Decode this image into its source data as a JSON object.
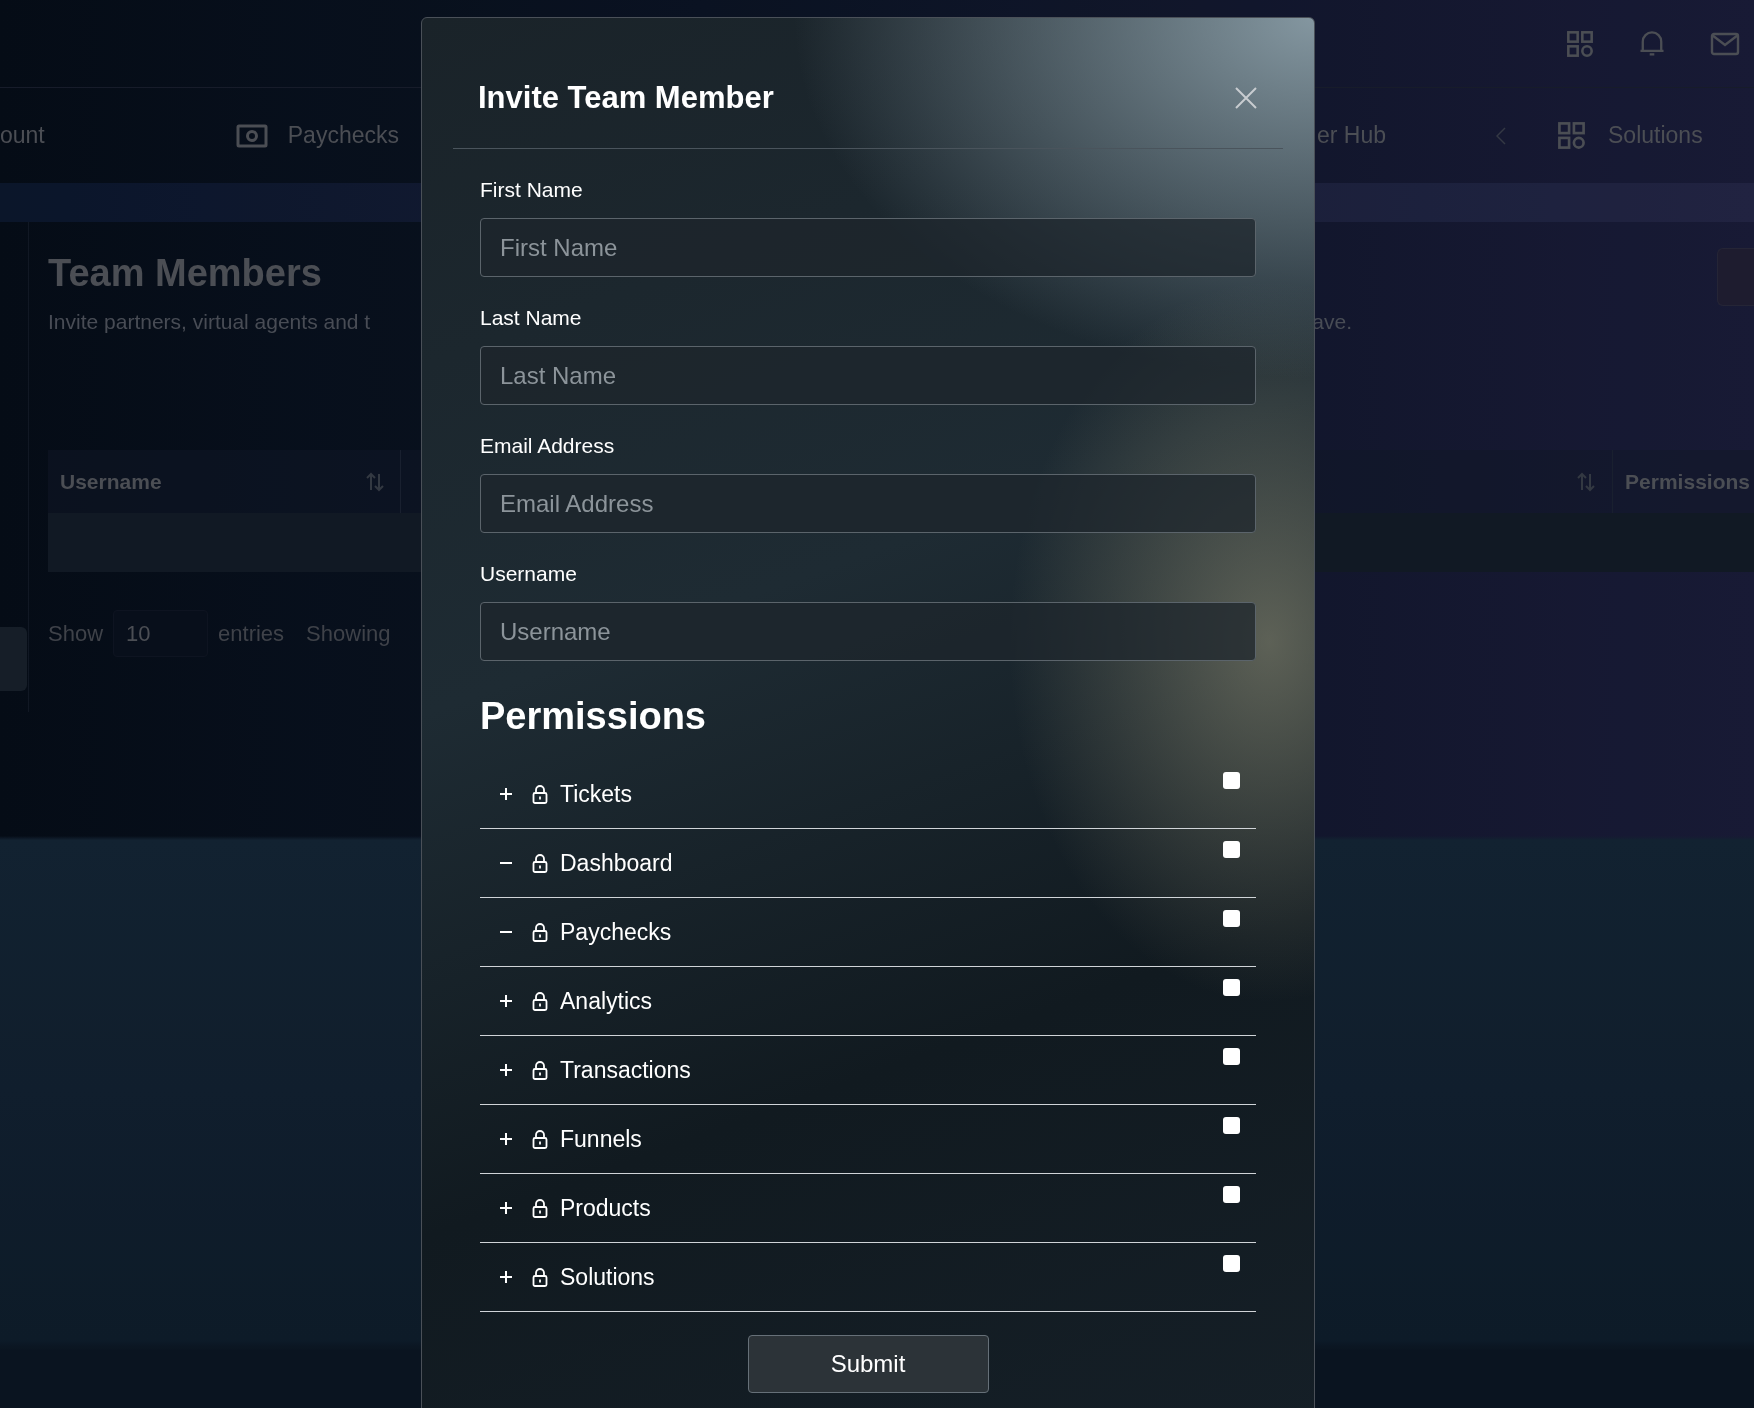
{
  "nav": {
    "items": [
      "ount",
      "Paychecks",
      "er Hub",
      "Solutions"
    ]
  },
  "page": {
    "title": "Team Members",
    "subtitle": "Invite partners, virtual agents and t",
    "subtitle_end": "ave.",
    "columns": [
      "Username",
      "Permissions"
    ],
    "show": "Show",
    "page_size": "10",
    "entries": "entries",
    "info": "Showing"
  },
  "modal": {
    "title": "Invite Team Member",
    "fields": [
      {
        "label": "First Name",
        "placeholder": "First Name"
      },
      {
        "label": "Last Name",
        "placeholder": "Last Name"
      },
      {
        "label": "Email Address",
        "placeholder": "Email Address"
      },
      {
        "label": "Username",
        "placeholder": "Username"
      }
    ],
    "permissions_title": "Permissions",
    "permissions": [
      {
        "label": "Tickets",
        "expanded": false,
        "checked": false
      },
      {
        "label": "Dashboard",
        "expanded": true,
        "checked": false
      },
      {
        "label": "Paychecks",
        "expanded": true,
        "checked": false
      },
      {
        "label": "Analytics",
        "expanded": false,
        "checked": false
      },
      {
        "label": "Transactions",
        "expanded": false,
        "checked": false
      },
      {
        "label": "Funnels",
        "expanded": false,
        "checked": false
      },
      {
        "label": "Products",
        "expanded": false,
        "checked": false
      },
      {
        "label": "Solutions",
        "expanded": false,
        "checked": false
      }
    ],
    "submit": "Submit"
  }
}
